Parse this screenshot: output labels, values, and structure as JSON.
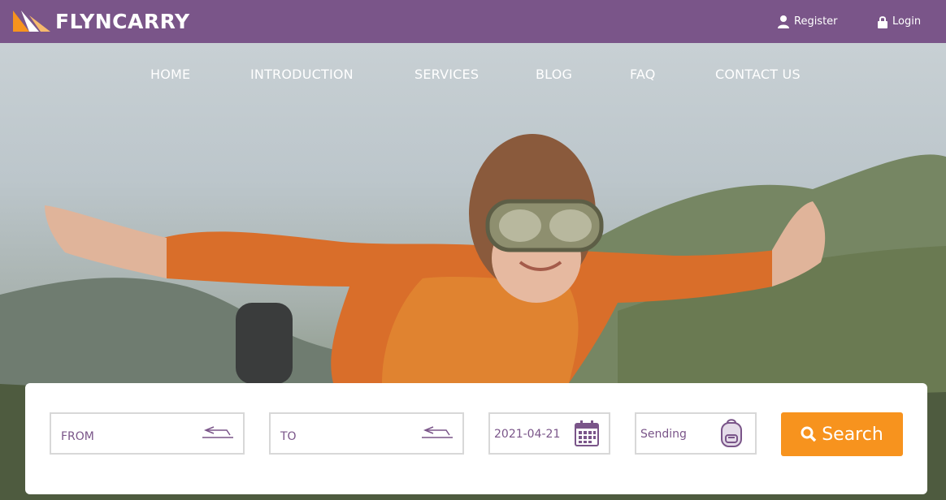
{
  "brand": {
    "name": "FLYNCARRY",
    "bar_color": "#7a5589",
    "accent": "#f7931e"
  },
  "auth": {
    "register_label": "Register",
    "login_label": "Login"
  },
  "nav": {
    "items": [
      {
        "label": "HOME"
      },
      {
        "label": "INTRODUCTION"
      },
      {
        "label": "SERVICES"
      },
      {
        "label": "BLOG"
      },
      {
        "label": "FAQ"
      },
      {
        "label": "CONTACT US"
      }
    ]
  },
  "hero": {
    "image_icon": "boy-aviator-hero-image"
  },
  "search_form": {
    "from_placeholder": "FROM",
    "to_placeholder": "TO",
    "date_value": "2021-04-21",
    "type_value": "Sending",
    "search_label": "Search",
    "icons": {
      "from": "departure-icon",
      "to": "arrival-icon",
      "date": "calendar-icon",
      "type": "backpack-icon",
      "search": "search-icon"
    }
  }
}
